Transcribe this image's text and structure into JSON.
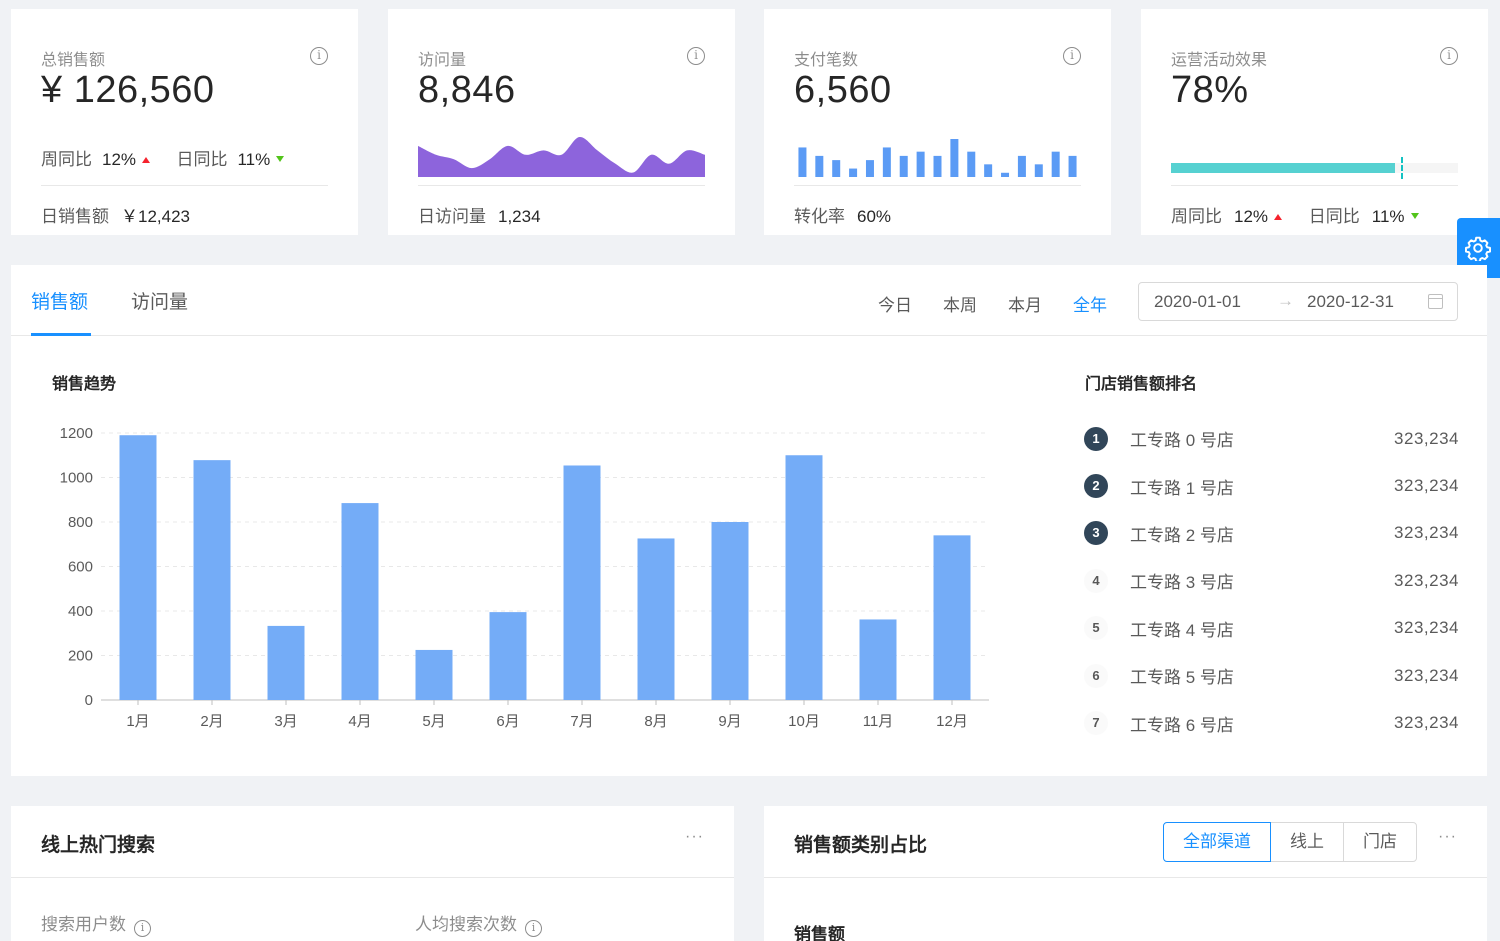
{
  "colors": {
    "primary": "#1890ff",
    "bar": "#74acf7",
    "area": "#8d64dc",
    "mini_bar": "#5b9bf5",
    "progress": "#13c2c2",
    "up": "#f5222d",
    "down": "#52c41a"
  },
  "stat_cards": [
    {
      "title": "总销售额",
      "total": "¥ 126,560",
      "trends": [
        {
          "label": "周同比",
          "value": "12%",
          "direction": "up"
        },
        {
          "label": "日同比",
          "value": "11%",
          "direction": "down"
        }
      ],
      "footer_label": "日销售额",
      "footer_value": "￥12,423",
      "info_icon": "info-circle-icon"
    },
    {
      "title": "访问量",
      "total": "8,846",
      "sparkline": [
        7,
        5,
        4,
        2,
        4,
        7,
        5,
        6,
        5,
        9,
        6,
        3,
        1,
        5,
        3,
        6,
        5
      ],
      "footer_label": "日访问量",
      "footer_value": "1,234",
      "info_icon": "info-circle-icon"
    },
    {
      "title": "支付笔数",
      "total": "6,560",
      "minibar": [
        7,
        5,
        4,
        2,
        4,
        7,
        5,
        6,
        5,
        9,
        6,
        3,
        1,
        5,
        3,
        6,
        5
      ],
      "footer_label": "转化率",
      "footer_value": "60%",
      "info_icon": "info-circle-icon"
    },
    {
      "title": "运营活动效果",
      "total": "78%",
      "progress_percent": 78,
      "target_percent": 80,
      "trends": [
        {
          "label": "周同比",
          "value": "12%",
          "direction": "up"
        },
        {
          "label": "日同比",
          "value": "11%",
          "direction": "down"
        }
      ],
      "info_icon": "info-circle-icon"
    }
  ],
  "settings_icon": "gear-icon",
  "sales_card": {
    "tabs": [
      {
        "label": "销售额",
        "active": true
      },
      {
        "label": "访问量",
        "active": false
      }
    ],
    "ranges": [
      {
        "label": "今日",
        "active": false
      },
      {
        "label": "本周",
        "active": false
      },
      {
        "label": "本月",
        "active": false
      },
      {
        "label": "全年",
        "active": true
      }
    ],
    "date_start": "2020-01-01",
    "date_sep": "→",
    "date_end": "2020-12-31",
    "chart_title": "销售趋势",
    "rank_title": "门店销售额排名",
    "ranking": [
      {
        "rank": "1",
        "name": "工专路 0 号店",
        "value": "323,234"
      },
      {
        "rank": "2",
        "name": "工专路 1 号店",
        "value": "323,234"
      },
      {
        "rank": "3",
        "name": "工专路 2 号店",
        "value": "323,234"
      },
      {
        "rank": "4",
        "name": "工专路 3 号店",
        "value": "323,234"
      },
      {
        "rank": "5",
        "name": "工专路 4 号店",
        "value": "323,234"
      },
      {
        "rank": "6",
        "name": "工专路 5 号店",
        "value": "323,234"
      },
      {
        "rank": "7",
        "name": "工专路 6 号店",
        "value": "323,234"
      }
    ]
  },
  "chart_data": {
    "type": "bar",
    "title": "销售趋势",
    "categories": [
      "1月",
      "2月",
      "3月",
      "4月",
      "5月",
      "6月",
      "7月",
      "8月",
      "9月",
      "10月",
      "11月",
      "12月"
    ],
    "values": [
      1190,
      1078,
      333,
      885,
      225,
      395,
      1054,
      726,
      800,
      1100,
      362,
      740
    ],
    "xlabel": "",
    "ylabel": "",
    "ylim": [
      0,
      1200
    ],
    "yticks": [
      0,
      200,
      400,
      600,
      800,
      1000,
      1200
    ],
    "grid": true,
    "legend": "none"
  },
  "search_card": {
    "title": "线上热门搜索",
    "more": "···",
    "metrics": [
      {
        "label": "搜索用户数"
      },
      {
        "label": "人均搜索次数"
      }
    ]
  },
  "category_card": {
    "title": "销售额类别占比",
    "channels": [
      {
        "label": "全部渠道",
        "active": true
      },
      {
        "label": "线上",
        "active": false
      },
      {
        "label": "门店",
        "active": false
      }
    ],
    "more": "···",
    "sub_title": "销售额"
  }
}
